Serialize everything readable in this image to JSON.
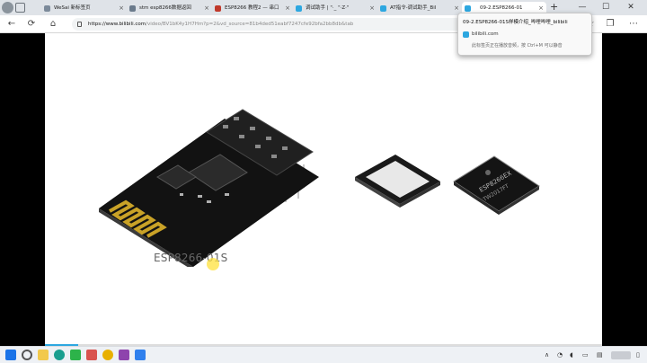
{
  "colors": {
    "accent": "#2da7e0",
    "slide_bg": "#ffffff",
    "letterbox": "#000000",
    "cursor_highlight": "#ffe13c"
  },
  "tabs": [
    {
      "label": "WeSai 新标签页",
      "icon": "page-icon",
      "color": "#7c8a9a"
    },
    {
      "label": "stm esp8266数据返回",
      "icon": "page-icon",
      "color": "#6b7b8c"
    },
    {
      "label": "ESP8266 教程2 — 串口",
      "icon": "page-icon",
      "color": "#c0392b"
    },
    {
      "label": "调试助手 | \"·_ \"·Z·\"",
      "icon": "bilibili-icon",
      "color": "#2da7e0"
    },
    {
      "label": "AT指令-调试助手_Bil",
      "icon": "bilibili-icon",
      "color": "#2da7e0"
    },
    {
      "label": "09-2.ESP8266-01",
      "icon": "bilibili-icon",
      "color": "#2da7e0",
      "active": true
    }
  ],
  "window": {
    "minimize": "—",
    "maximize": "☐",
    "close": "✕",
    "new_tab": "+"
  },
  "address_bar": {
    "host": "https://www.bilibili.com",
    "path": "/video/BV1bK4y1H7Hm?p=2&vd_source=81b4ded51eabf7247cfe92bfa2bb8db&tab"
  },
  "tooltip": {
    "title": "09-2.ESP8266-01S样模介绍_哔哩哔哩_bilibili",
    "domain": "bilibili.com",
    "note": "此标签页正在播放音频，按 Ctrl+M 可以静音"
  },
  "video": {
    "caption": "ESP8266-01S",
    "chip_text_1": "ESP8266EX",
    "chip_text_2": "TW2017FT",
    "progress": 0.06
  },
  "taskbar": {
    "apps": [
      {
        "icon": "windows-start-icon",
        "color": "#1a73e8"
      },
      {
        "icon": "search-icon",
        "color": "#555555"
      },
      {
        "icon": "file-explorer-icon",
        "color": "#f2c94c"
      },
      {
        "icon": "edge-icon",
        "color": "#1a9e8f"
      },
      {
        "icon": "wechat-icon",
        "color": "#2db34a"
      },
      {
        "icon": "app-icon",
        "color": "#d9534f"
      },
      {
        "icon": "chrome-icon",
        "color": "#e8b000"
      },
      {
        "icon": "app-icon",
        "color": "#8e44ad"
      },
      {
        "icon": "vscode-icon",
        "color": "#2f80ed"
      }
    ]
  }
}
